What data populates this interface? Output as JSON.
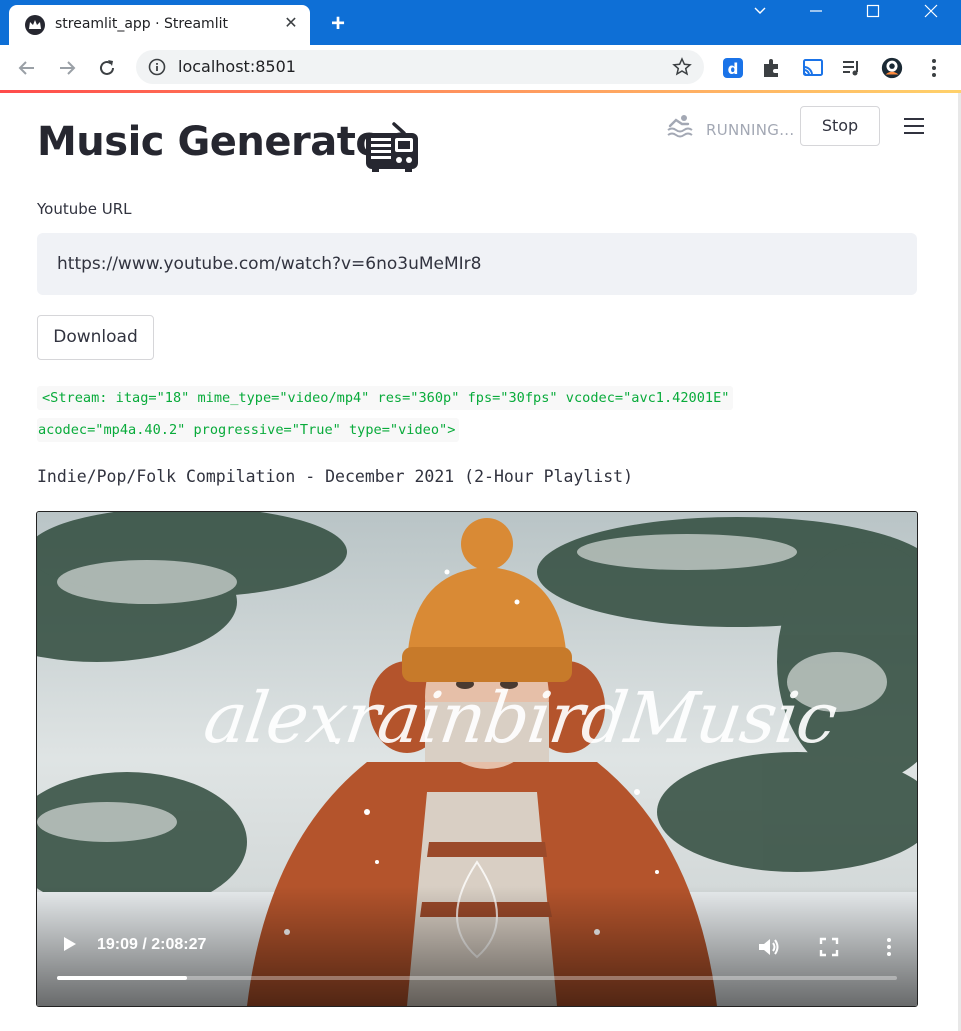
{
  "browser": {
    "tab_title": "streamlit_app · Streamlit",
    "tab_close": "✕",
    "new_tab": "+",
    "url": "localhost:8501",
    "favicon": "streamlit-crown-icon"
  },
  "app": {
    "status": "RUNNING...",
    "stop_label": "Stop",
    "title": "Music Generator",
    "title_emoji": "radio-icon",
    "url_field": {
      "label": "Youtube URL",
      "value": "https://www.youtube.com/watch?v=6no3uMeMIr8"
    },
    "download_label": "Download",
    "stream_info": {
      "line1": "<Stream: itag=\"18\" mime_type=\"video/mp4\" res=\"360p\" fps=\"30fps\" vcodec=\"avc1.42001E\"",
      "line2": "acodec=\"mp4a.40.2\" progressive=\"True\" type=\"video\">"
    },
    "video_title": "Indie/Pop/Folk Compilation - December 2021 (2-Hour Playlist)",
    "video": {
      "watermark": "alexrainbirdMusic",
      "time": "19:09 / 2:08:27",
      "progress": 0.155
    }
  },
  "colors": {
    "titlebar": "#0e6fd6",
    "code_text": "#09ab3b",
    "input_bg": "#f0f2f6",
    "status_text": "#a3a8b4"
  }
}
